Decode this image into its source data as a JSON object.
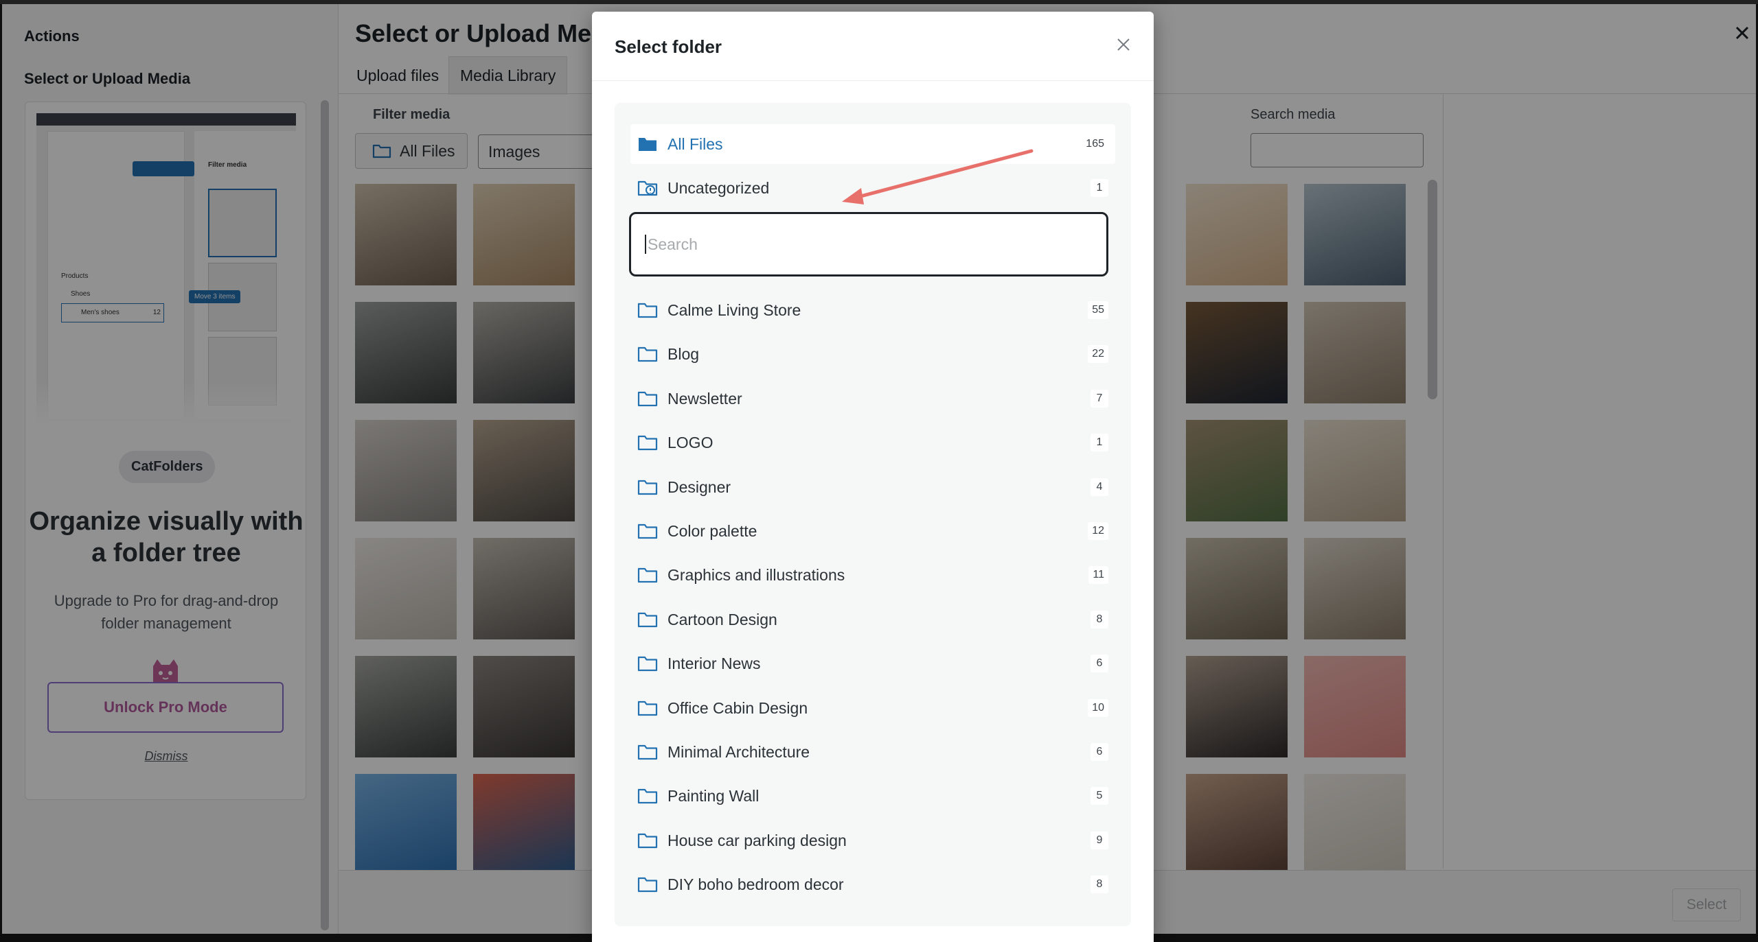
{
  "media_modal": {
    "menu": {
      "heading": "Actions",
      "item": "Select or Upload Media"
    },
    "promo": {
      "screenshot_title": "Filter media",
      "screenshot_tree": [
        "Products",
        "Shoes",
        "Men's shoes"
      ],
      "screenshot_tree_count": "12",
      "screenshot_badge": "Move 3 items",
      "badge": "CatFolders",
      "title": "Organize visually with a folder tree",
      "subtitle": "Upgrade to Pro for drag-and-drop folder management",
      "cta": "Unlock Pro Mode",
      "dismiss": "Dismiss"
    },
    "title": "Select or Upload Media",
    "tabs": [
      {
        "label": "Upload files",
        "active": false
      },
      {
        "label": "Media Library",
        "active": true
      }
    ],
    "filter_label": "Filter media",
    "all_files_button": "All Files",
    "type_select": "Images",
    "search_label": "Search media",
    "select_button": "Select"
  },
  "dialog": {
    "title": "Select folder",
    "search_placeholder": "Search",
    "all_files": {
      "name": "All Files",
      "count": "165"
    },
    "uncategorized": {
      "name": "Uncategorized",
      "count": "1"
    },
    "folders": [
      {
        "name": "Calme Living Store",
        "count": "55"
      },
      {
        "name": "Blog",
        "count": "22"
      },
      {
        "name": "Newsletter",
        "count": "7"
      },
      {
        "name": "LOGO",
        "count": "1"
      },
      {
        "name": "Designer",
        "count": "4"
      },
      {
        "name": "Color palette",
        "count": "12"
      },
      {
        "name": "Graphics and illustrations",
        "count": "11"
      },
      {
        "name": "Cartoon Design",
        "count": "8"
      },
      {
        "name": "Interior News",
        "count": "6"
      },
      {
        "name": "Office Cabin Design",
        "count": "10"
      },
      {
        "name": "Minimal Architecture",
        "count": "6"
      },
      {
        "name": "Painting Wall",
        "count": "5"
      },
      {
        "name": "House car parking design",
        "count": "9"
      },
      {
        "name": "DIY boho bedroom decor",
        "count": "8"
      }
    ]
  },
  "colors": {
    "accent": "#2271b1",
    "annotation_arrow": "#e8706a",
    "unlock_border": "#8c6dcf"
  }
}
